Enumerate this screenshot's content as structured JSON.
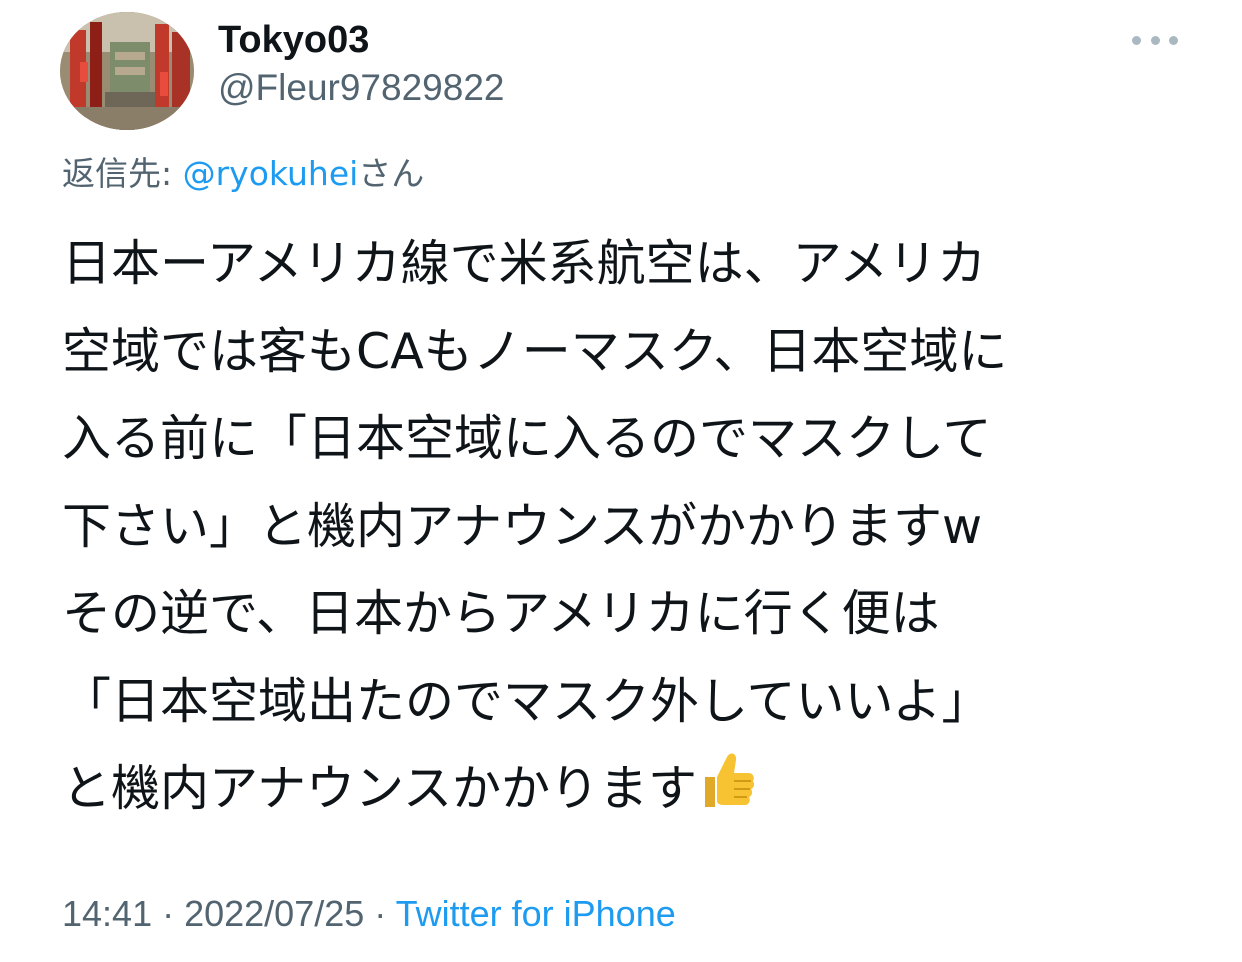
{
  "author": {
    "display_name": "Tokyo03",
    "handle": "@Fleur97829822"
  },
  "more_icon": "more-horizontal-icon",
  "reply": {
    "prefix": "返信先: ",
    "mention": "@ryokuhei",
    "suffix": "さん"
  },
  "tweet": {
    "lines": [
      "日本ーアメリカ線で米系航空は、アメリカ",
      "空域では客もCAもノーマスク、日本空域に",
      "入る前に「日本空域に入るのでマスクして",
      "下さい」と機内アナウンスがかかりますw",
      "その逆で、日本からアメリカに行く便は",
      "「日本空域出たのでマスク外していいよ」",
      "と機内アナウンスかかります"
    ],
    "emoji": "thumbs-up-icon"
  },
  "meta": {
    "time": "14:41",
    "separator": " · ",
    "date": "2022/07/25",
    "source": "Twitter for iPhone"
  },
  "colors": {
    "text": "#0f1419",
    "secondary": "#536471",
    "link": "#1d9bf0",
    "more_dots": "#aab8c2"
  }
}
